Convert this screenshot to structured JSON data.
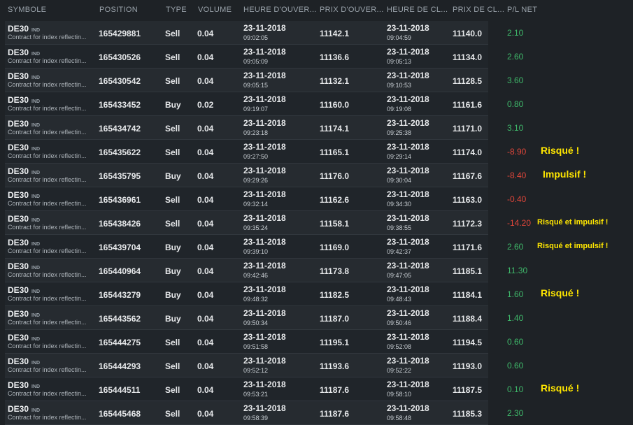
{
  "headers": {
    "symbol": "SYMBOLE",
    "position": "POSITION",
    "type": "TYPE",
    "volume": "VOLUME",
    "open_time": "HEURE D'OUVER...",
    "open_price": "PRIX D'OUVER...",
    "close_time": "HEURE DE CL...",
    "close_price": "PRIX DE CL...",
    "pl": "P/L NET"
  },
  "colors": {
    "positive": "#3fb86a",
    "negative": "#e0463a",
    "note": "#ffe600"
  },
  "rows": [
    {
      "symbol": "DE30",
      "tag": "IND",
      "desc": "Contract for index reflectin...",
      "position": "165429881",
      "type": "Sell",
      "volume": "0.04",
      "open_date": "23-11-2018",
      "open_time": "09:02:05",
      "open_price": "11142.1",
      "close_date": "23-11-2018",
      "close_time": "09:04:59",
      "close_price": "11140.0",
      "pl": "2.10",
      "note": ""
    },
    {
      "symbol": "DE30",
      "tag": "IND",
      "desc": "Contract for index reflectin...",
      "position": "165430526",
      "type": "Sell",
      "volume": "0.04",
      "open_date": "23-11-2018",
      "open_time": "09:05:09",
      "open_price": "11136.6",
      "close_date": "23-11-2018",
      "close_time": "09:05:13",
      "close_price": "11134.0",
      "pl": "2.60",
      "note": ""
    },
    {
      "symbol": "DE30",
      "tag": "IND",
      "desc": "Contract for index reflectin...",
      "position": "165430542",
      "type": "Sell",
      "volume": "0.04",
      "open_date": "23-11-2018",
      "open_time": "09:05:15",
      "open_price": "11132.1",
      "close_date": "23-11-2018",
      "close_time": "09:10:53",
      "close_price": "11128.5",
      "pl": "3.60",
      "note": ""
    },
    {
      "symbol": "DE30",
      "tag": "IND",
      "desc": "Contract for index reflectin...",
      "position": "165433452",
      "type": "Buy",
      "volume": "0.02",
      "open_date": "23-11-2018",
      "open_time": "09:19:07",
      "open_price": "11160.0",
      "close_date": "23-11-2018",
      "close_time": "09:19:08",
      "close_price": "11161.6",
      "pl": "0.80",
      "note": ""
    },
    {
      "symbol": "DE30",
      "tag": "IND",
      "desc": "Contract for index reflectin...",
      "position": "165434742",
      "type": "Sell",
      "volume": "0.04",
      "open_date": "23-11-2018",
      "open_time": "09:23:18",
      "open_price": "11174.1",
      "close_date": "23-11-2018",
      "close_time": "09:25:38",
      "close_price": "11171.0",
      "pl": "3.10",
      "note": ""
    },
    {
      "symbol": "DE30",
      "tag": "IND",
      "desc": "Contract for index reflectin...",
      "position": "165435622",
      "type": "Sell",
      "volume": "0.04",
      "open_date": "23-11-2018",
      "open_time": "09:27:50",
      "open_price": "11165.1",
      "close_date": "23-11-2018",
      "close_time": "09:29:14",
      "close_price": "11174.0",
      "pl": "-8.90",
      "note": "Risqué !"
    },
    {
      "symbol": "DE30",
      "tag": "IND",
      "desc": "Contract for index reflectin...",
      "position": "165435795",
      "type": "Buy",
      "volume": "0.04",
      "open_date": "23-11-2018",
      "open_time": "09:29:26",
      "open_price": "11176.0",
      "close_date": "23-11-2018",
      "close_time": "09:30:04",
      "close_price": "11167.6",
      "pl": "-8.40",
      "note": "Impulsif !"
    },
    {
      "symbol": "DE30",
      "tag": "IND",
      "desc": "Contract for index reflectin...",
      "position": "165436961",
      "type": "Sell",
      "volume": "0.04",
      "open_date": "23-11-2018",
      "open_time": "09:32:14",
      "open_price": "11162.6",
      "close_date": "23-11-2018",
      "close_time": "09:34:30",
      "close_price": "11163.0",
      "pl": "-0.40",
      "note": ""
    },
    {
      "symbol": "DE30",
      "tag": "IND",
      "desc": "Contract for index reflectin...",
      "position": "165438426",
      "type": "Sell",
      "volume": "0.04",
      "open_date": "23-11-2018",
      "open_time": "09:35:24",
      "open_price": "11158.1",
      "close_date": "23-11-2018",
      "close_time": "09:38:55",
      "close_price": "11172.3",
      "pl": "-14.20",
      "note": "Risqué et impulsif !"
    },
    {
      "symbol": "DE30",
      "tag": "IND",
      "desc": "Contract for index reflectin...",
      "position": "165439704",
      "type": "Buy",
      "volume": "0.04",
      "open_date": "23-11-2018",
      "open_time": "09:39:10",
      "open_price": "11169.0",
      "close_date": "23-11-2018",
      "close_time": "09:42:37",
      "close_price": "11171.6",
      "pl": "2.60",
      "note": "Risqué et impulsif !"
    },
    {
      "symbol": "DE30",
      "tag": "IND",
      "desc": "Contract for index reflectin...",
      "position": "165440964",
      "type": "Buy",
      "volume": "0.04",
      "open_date": "23-11-2018",
      "open_time": "09:42:46",
      "open_price": "11173.8",
      "close_date": "23-11-2018",
      "close_time": "09:47:05",
      "close_price": "11185.1",
      "pl": "11.30",
      "note": ""
    },
    {
      "symbol": "DE30",
      "tag": "IND",
      "desc": "Contract for index reflectin...",
      "position": "165443279",
      "type": "Buy",
      "volume": "0.04",
      "open_date": "23-11-2018",
      "open_time": "09:48:32",
      "open_price": "11182.5",
      "close_date": "23-11-2018",
      "close_time": "09:48:43",
      "close_price": "11184.1",
      "pl": "1.60",
      "note": "Risqué !"
    },
    {
      "symbol": "DE30",
      "tag": "IND",
      "desc": "Contract for index reflectin...",
      "position": "165443562",
      "type": "Buy",
      "volume": "0.04",
      "open_date": "23-11-2018",
      "open_time": "09:50:34",
      "open_price": "11187.0",
      "close_date": "23-11-2018",
      "close_time": "09:50:46",
      "close_price": "11188.4",
      "pl": "1.40",
      "note": ""
    },
    {
      "symbol": "DE30",
      "tag": "IND",
      "desc": "Contract for index reflectin...",
      "position": "165444275",
      "type": "Sell",
      "volume": "0.04",
      "open_date": "23-11-2018",
      "open_time": "09:51:58",
      "open_price": "11195.1",
      "close_date": "23-11-2018",
      "close_time": "09:52:08",
      "close_price": "11194.5",
      "pl": "0.60",
      "note": ""
    },
    {
      "symbol": "DE30",
      "tag": "IND",
      "desc": "Contract for index reflectin...",
      "position": "165444293",
      "type": "Sell",
      "volume": "0.04",
      "open_date": "23-11-2018",
      "open_time": "09:52:12",
      "open_price": "11193.6",
      "close_date": "23-11-2018",
      "close_time": "09:52:22",
      "close_price": "11193.0",
      "pl": "0.60",
      "note": ""
    },
    {
      "symbol": "DE30",
      "tag": "IND",
      "desc": "Contract for index reflectin...",
      "position": "165444511",
      "type": "Sell",
      "volume": "0.04",
      "open_date": "23-11-2018",
      "open_time": "09:53:21",
      "open_price": "11187.6",
      "close_date": "23-11-2018",
      "close_time": "09:58:10",
      "close_price": "11187.5",
      "pl": "0.10",
      "note": "Risqué !"
    },
    {
      "symbol": "DE30",
      "tag": "IND",
      "desc": "Contract for index reflectin...",
      "position": "165445468",
      "type": "Sell",
      "volume": "0.04",
      "open_date": "23-11-2018",
      "open_time": "09:58:39",
      "open_price": "11187.6",
      "close_date": "23-11-2018",
      "close_time": "09:58:48",
      "close_price": "11185.3",
      "pl": "2.30",
      "note": ""
    }
  ]
}
